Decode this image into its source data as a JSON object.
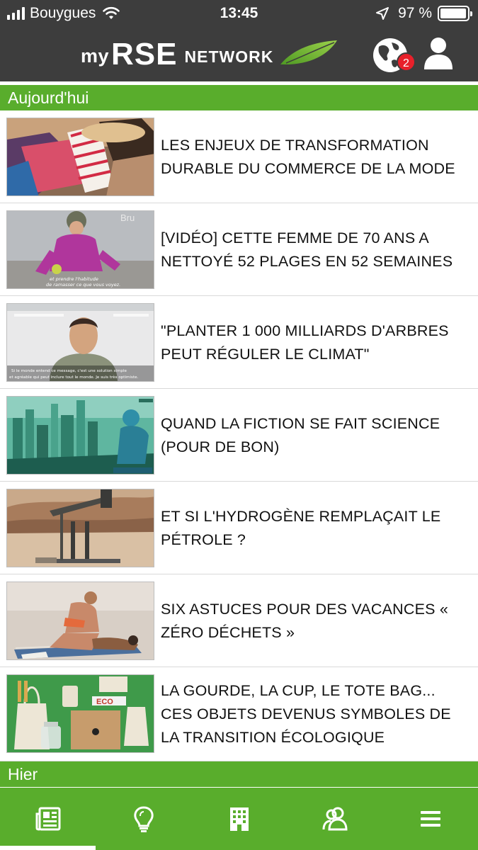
{
  "status_bar": {
    "carrier": "Bouygues",
    "time": "13:45",
    "battery": "97 %",
    "battery_level": 0.97
  },
  "header": {
    "logo_my": "my",
    "logo_rse": "RSE",
    "logo_network": "NETWORK",
    "notifications_count": "2",
    "icons": [
      "globe-icon",
      "user-icon"
    ]
  },
  "sections": {
    "today": "Aujourd'hui",
    "yesterday": "Hier"
  },
  "articles": [
    {
      "title": "LES ENJEUX DE TRANSFORMATION DURABLE DU COMMERCE DE LA MODE"
    },
    {
      "title": "[VIDÉO] CETTE FEMME DE 70 ANS A NETTOYÉ 52 PLAGES EN 52 SEMAINES",
      "thumb_caption_1": "et prendre l'habitude",
      "thumb_caption_2": "de ramasser ce que vous voyez.",
      "thumb_watermark": "Bru"
    },
    {
      "title": "\"PLANTER 1 000 MILLIARDS D'ARBRES PEUT RÉGULER LE CLIMAT\"",
      "thumb_caption_1": "Si le monde entend ce message, c'est une solution simple",
      "thumb_caption_2": "et agréable qui peut inclure tout le monde. Je suis très optimiste."
    },
    {
      "title": "QUAND LA FICTION SE FAIT SCIENCE (POUR DE BON)"
    },
    {
      "title": "ET SI L'HYDROGÈNE REMPLAÇAIT LE PÉTROLE ?"
    },
    {
      "title": "SIX ASTUCES POUR DES VACANCES « ZÉRO DÉCHETS »"
    },
    {
      "title": "LA GOURDE, LA CUP, LE TOTE BAG... CES OBJETS DEVENUS SYMBOLES DE LA TRANSITION ÉCOLOGIQUE",
      "thumb_label": "ECO"
    }
  ],
  "tabbar": {
    "tabs": [
      "news-icon",
      "lightbulb-icon",
      "building-icon",
      "community-icon",
      "menu-icon"
    ],
    "active_index": 0
  },
  "colors": {
    "header_bg": "#3d3d3d",
    "brand_green": "#59ad2c",
    "badge_red": "#e8202a"
  }
}
